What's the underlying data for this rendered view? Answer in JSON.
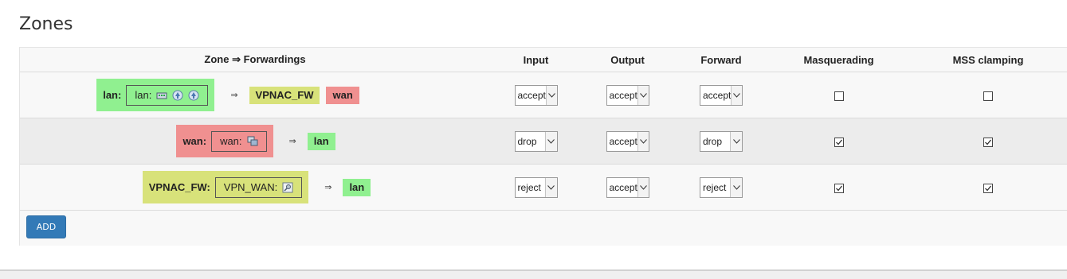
{
  "page": {
    "title": "Zones"
  },
  "colors": {
    "lan": "#90f090",
    "wan": "#f09090",
    "vpnac": "#d8e27a",
    "add_button": "#337ab7"
  },
  "headers": {
    "zone": "Zone ⇒ Forwardings",
    "input": "Input",
    "output": "Output",
    "forward": "Forward",
    "masquerading": "Masquerading",
    "mss": "MSS clamping"
  },
  "arrow": "⇒",
  "rows": [
    {
      "zone": "lan:",
      "network_label": "lan:",
      "network_icons": [
        "ethernet-switch-icon",
        "wifi-icon",
        "wifi-icon"
      ],
      "forwardings": [
        {
          "label": "VPNAC_FW",
          "zone": "vpnac"
        },
        {
          "label": "wan",
          "zone": "wan"
        }
      ],
      "input": "accept",
      "output": "accept",
      "forward": "accept",
      "masquerading": false,
      "mss": false
    },
    {
      "zone": "wan:",
      "network_label": "wan:",
      "network_icons": [
        "ethernet-port-icon"
      ],
      "forwardings": [
        {
          "label": "lan",
          "zone": "lan"
        }
      ],
      "input": "drop",
      "output": "accept",
      "forward": "drop",
      "masquerading": true,
      "mss": true
    },
    {
      "zone": "VPNAC_FW:",
      "network_label": "VPN_WAN:",
      "network_icons": [
        "vpn-tunnel-icon"
      ],
      "forwardings": [
        {
          "label": "lan",
          "zone": "lan"
        }
      ],
      "input": "reject",
      "output": "accept",
      "forward": "reject",
      "masquerading": true,
      "mss": true
    }
  ],
  "add_button": "ADD"
}
